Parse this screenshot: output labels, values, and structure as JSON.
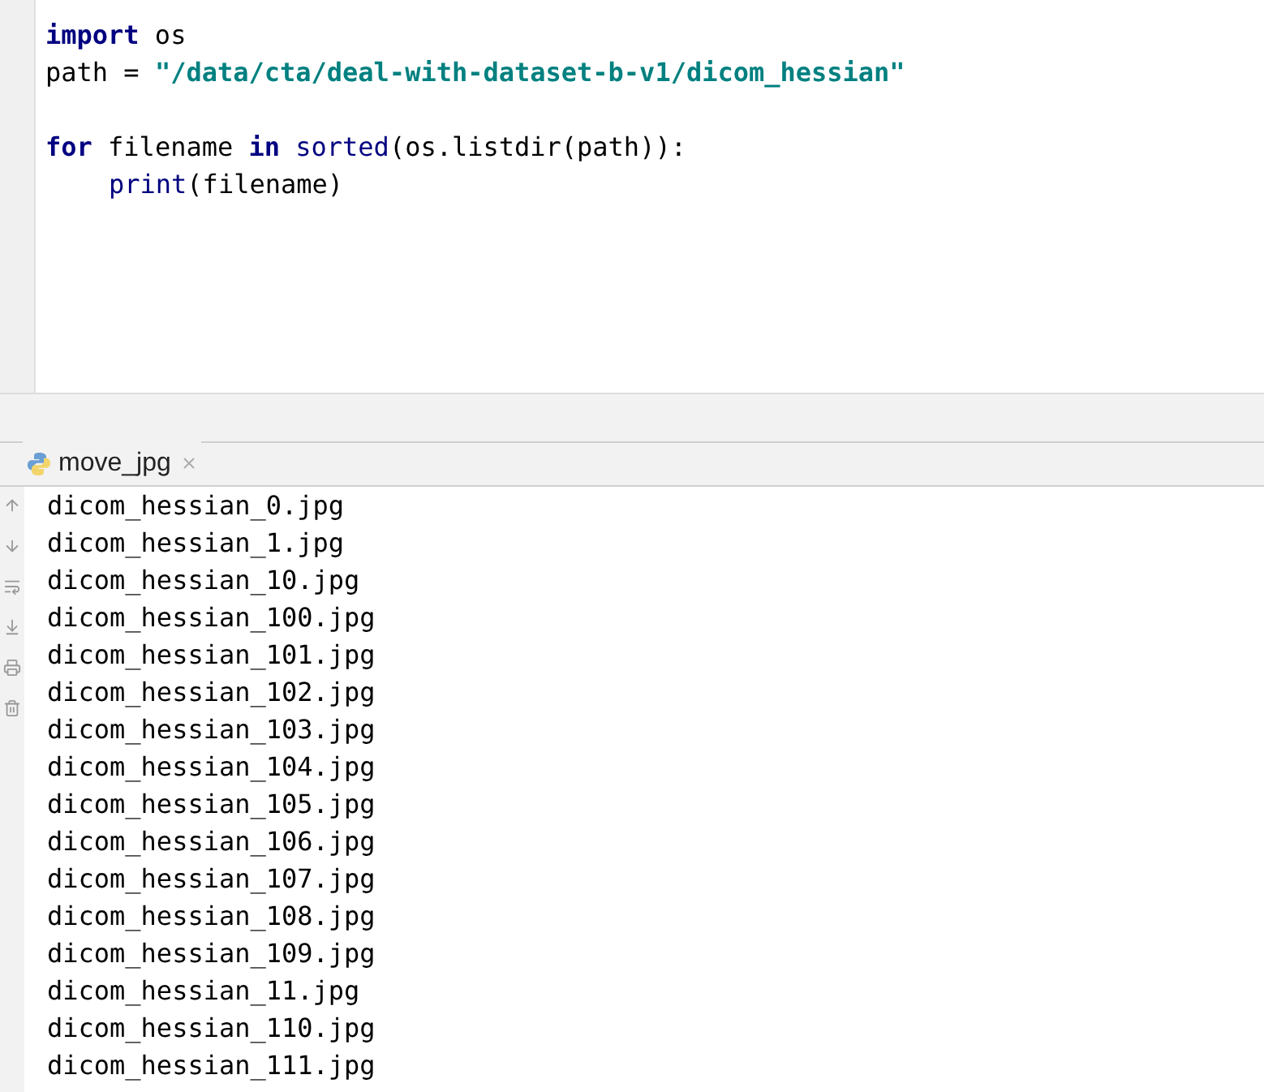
{
  "editor": {
    "blocks": [
      {
        "lines": [
          {
            "tokens": [
              {
                "text": "import",
                "kind": "keyword"
              },
              {
                "text": " os",
                "kind": "plain"
              }
            ]
          },
          {
            "tokens": [
              {
                "text": "path = ",
                "kind": "plain"
              },
              {
                "text": "\"/data/cta/deal-with-dataset-b-v1/dicom_hessian\"",
                "kind": "string"
              }
            ]
          }
        ]
      },
      {
        "lines": [
          {
            "tokens": [
              {
                "text": "for",
                "kind": "keyword"
              },
              {
                "text": " filename ",
                "kind": "plain"
              },
              {
                "text": "in",
                "kind": "keyword"
              },
              {
                "text": " sorted",
                "kind": "builtin"
              },
              {
                "text": "(os.listdir(path)):",
                "kind": "plain"
              }
            ],
            "children": [
              {
                "tokens": [
                  {
                    "text": "print",
                    "kind": "builtin"
                  },
                  {
                    "text": "(filename)",
                    "kind": "plain"
                  }
                ]
              }
            ]
          }
        ]
      }
    ]
  },
  "run_tabs": [
    {
      "label": "move_jpg",
      "selected": true
    }
  ],
  "output": [
    "dicom_hessian_0.jpg",
    "dicom_hessian_1.jpg",
    "dicom_hessian_10.jpg",
    "dicom_hessian_100.jpg",
    "dicom_hessian_101.jpg",
    "dicom_hessian_102.jpg",
    "dicom_hessian_103.jpg",
    "dicom_hessian_104.jpg",
    "dicom_hessian_105.jpg",
    "dicom_hessian_106.jpg",
    "dicom_hessian_107.jpg",
    "dicom_hessian_108.jpg",
    "dicom_hessian_109.jpg",
    "dicom_hessian_11.jpg",
    "dicom_hessian_110.jpg",
    "dicom_hessian_111.jpg"
  ]
}
